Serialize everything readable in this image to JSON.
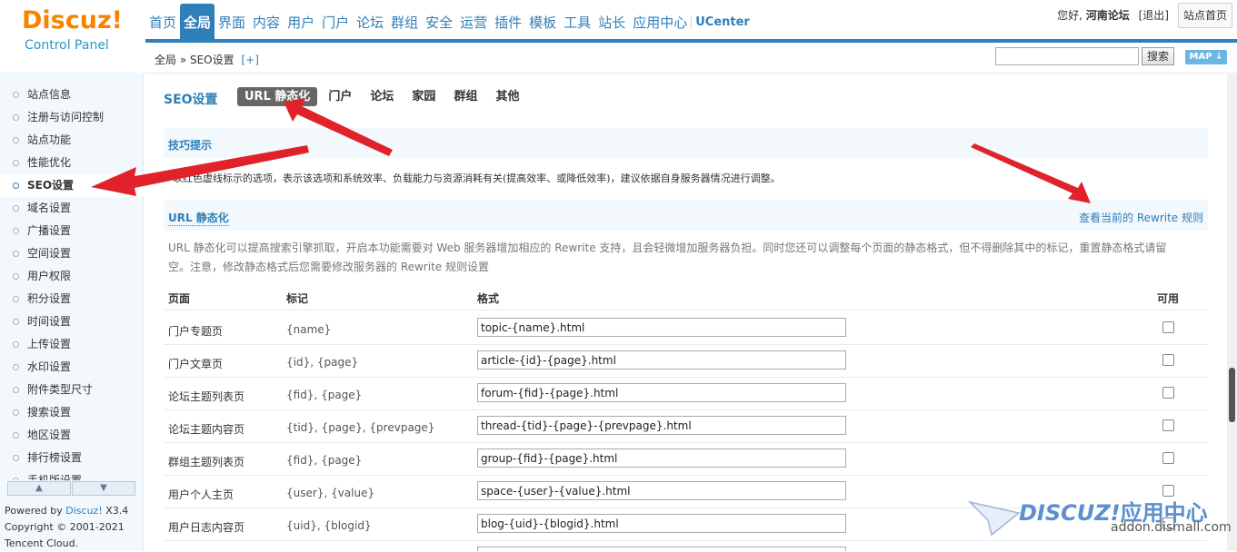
{
  "logo": {
    "brand": "Discuz!",
    "sub": "Control Panel"
  },
  "topnav": [
    {
      "label": "首页",
      "active": false
    },
    {
      "label": "全局",
      "active": true
    },
    {
      "label": "界面",
      "active": false
    },
    {
      "label": "内容",
      "active": false
    },
    {
      "label": "用户",
      "active": false
    },
    {
      "label": "门户",
      "active": false
    },
    {
      "label": "论坛",
      "active": false
    },
    {
      "label": "群组",
      "active": false
    },
    {
      "label": "安全",
      "active": false
    },
    {
      "label": "运营",
      "active": false
    },
    {
      "label": "插件",
      "active": false
    },
    {
      "label": "模板",
      "active": false
    },
    {
      "label": "工具",
      "active": false
    },
    {
      "label": "站长",
      "active": false
    },
    {
      "label": "应用中心",
      "active": false
    },
    {
      "label": "UCenter",
      "active": false
    }
  ],
  "user": {
    "greeting": "您好,",
    "name": "河南论坛",
    "logout": "[退出]",
    "site_home": "站点首页"
  },
  "breadcrumb": {
    "path": "全局 » SEO设置",
    "plus": "[+]"
  },
  "search": {
    "button": "搜索",
    "map": "MAP ↓"
  },
  "sidebar": {
    "items": [
      {
        "label": "站点信息",
        "active": false
      },
      {
        "label": "注册与访问控制",
        "active": false
      },
      {
        "label": "站点功能",
        "active": false
      },
      {
        "label": "性能优化",
        "active": false
      },
      {
        "label": "SEO设置",
        "active": true
      },
      {
        "label": "域名设置",
        "active": false
      },
      {
        "label": "广播设置",
        "active": false
      },
      {
        "label": "空间设置",
        "active": false
      },
      {
        "label": "用户权限",
        "active": false
      },
      {
        "label": "积分设置",
        "active": false
      },
      {
        "label": "时间设置",
        "active": false
      },
      {
        "label": "上传设置",
        "active": false
      },
      {
        "label": "水印设置",
        "active": false
      },
      {
        "label": "附件类型尺寸",
        "active": false
      },
      {
        "label": "搜索设置",
        "active": false
      },
      {
        "label": "地区设置",
        "active": false
      },
      {
        "label": "排行榜设置",
        "active": false
      },
      {
        "label": "手机版设置",
        "active": false
      }
    ],
    "scroll_up": "▲",
    "scroll_down": "▼",
    "powered_prefix": "Powered by ",
    "powered_brand": "Discuz!",
    "powered_version": " X3.4",
    "copyright": "Copyright © 2001-2021",
    "company": "Tencent Cloud."
  },
  "main": {
    "title": "SEO设置",
    "tabs": [
      {
        "label": "URL 静态化",
        "active": true
      },
      {
        "label": "门户",
        "active": false
      },
      {
        "label": "论坛",
        "active": false
      },
      {
        "label": "家园",
        "active": false
      },
      {
        "label": "群组",
        "active": false
      },
      {
        "label": "其他",
        "active": false
      }
    ],
    "tips_title": "技巧提示",
    "tips_text": "以红色虚线标示的选项，表示该选项和系统效率、负载能力与资源消耗有关(提高效率、或降低效率)，建议依据自身服务器情况进行调整。",
    "section_title": "URL 静态化",
    "section_link": "查看当前的 Rewrite 规则",
    "section_desc": "URL 静态化可以提高搜索引擎抓取，开启本功能需要对 Web 服务器增加相应的 Rewrite 支持，且会轻微增加服务器负担。同时您还可以调整每个页面的静态格式，但不得删除其中的标记，重置静态格式请留空。注意，修改静态格式后您需要修改服务器的 Rewrite 规则设置",
    "columns": {
      "page": "页面",
      "tags": "标记",
      "format": "格式",
      "enabled": "可用"
    },
    "rows": [
      {
        "page": "门户专题页",
        "tags": "{name}",
        "format": "topic-{name}.html"
      },
      {
        "page": "门户文章页",
        "tags": "{id}, {page}",
        "format": "article-{id}-{page}.html"
      },
      {
        "page": "论坛主题列表页",
        "tags": "{fid}, {page}",
        "format": "forum-{fid}-{page}.html"
      },
      {
        "page": "论坛主题内容页",
        "tags": "{tid}, {page}, {prevpage}",
        "format": "thread-{tid}-{page}-{prevpage}.html"
      },
      {
        "page": "群组主题列表页",
        "tags": "{fid}, {page}",
        "format": "group-{fid}-{page}.html"
      },
      {
        "page": "用户个人主页",
        "tags": "{user}, {value}",
        "format": "space-{user}-{value}.html"
      },
      {
        "page": "用户日志内容页",
        "tags": "{uid}, {blogid}",
        "format": "blog-{uid}-{blogid}.html"
      }
    ]
  },
  "watermark": {
    "brand": "DISCUZ!",
    "suffix": "应用中心",
    "url": "addon.dismall.com"
  },
  "colors": {
    "accent": "#2f7fb8",
    "logo": "#f68400",
    "arrow": "#e0222b"
  }
}
